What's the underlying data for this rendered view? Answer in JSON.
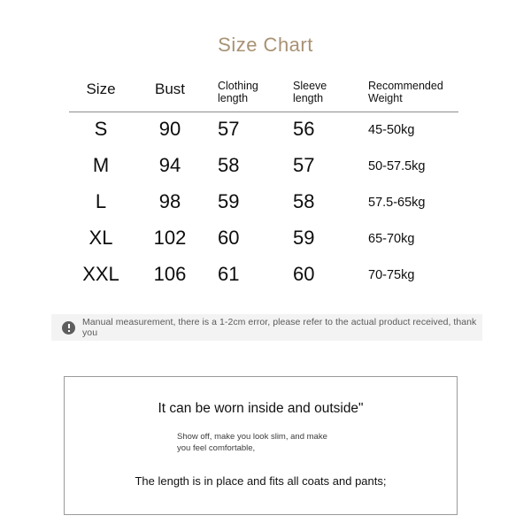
{
  "title": "Size Chart",
  "theme": {
    "title_color": "#a89274",
    "text_color": "#111111",
    "notice_background": "#f3f3f3",
    "notice_text_color": "#5a5a5a",
    "rule_color": "#8d8d8d",
    "box_border_color": "#9a9a9a",
    "page_background": "#ffffff"
  },
  "chart_data": {
    "type": "table",
    "title": "Size Chart",
    "columns": [
      "Size",
      "Bust",
      "Clothing\nlength",
      "Sleeve\nlength",
      "Recommended\nWeight"
    ],
    "rows": [
      {
        "size": "S",
        "bust": "90",
        "clothing_length": "57",
        "sleeve_length": "56",
        "recommended_weight": "45-50kg"
      },
      {
        "size": "M",
        "bust": "94",
        "clothing_length": "58",
        "sleeve_length": "57",
        "recommended_weight": "50-57.5kg"
      },
      {
        "size": "L",
        "bust": "98",
        "clothing_length": "59",
        "sleeve_length": "58",
        "recommended_weight": "57.5-65kg"
      },
      {
        "size": "XL",
        "bust": "102",
        "clothing_length": "60",
        "sleeve_length": "59",
        "recommended_weight": "65-70kg"
      },
      {
        "size": "XXL",
        "bust": "106",
        "clothing_length": "61",
        "sleeve_length": "60",
        "recommended_weight": "70-75kg"
      }
    ]
  },
  "notice": {
    "icon": "exclamation-circle-icon",
    "text": "Manual measurement, there is a 1-2cm error, please refer to the actual product received, thank you"
  },
  "info_box": {
    "line1": "It can be worn inside and outside\"",
    "line2": "Show off, make you look slim, and make\nyou feel comfortable,",
    "line3": "The length is in place and fits all coats and pants;"
  }
}
